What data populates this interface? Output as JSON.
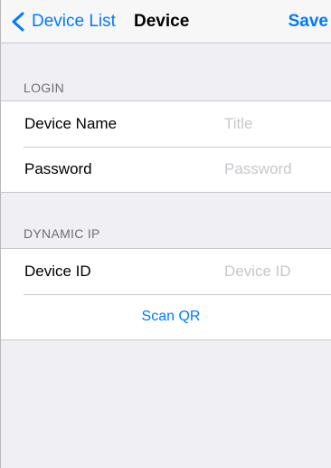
{
  "navbar": {
    "back_label": "Device List",
    "title": "Device",
    "save_label": "Save"
  },
  "sections": {
    "login": {
      "header": "LOGIN",
      "device_name": {
        "label": "Device Name",
        "placeholder": "Title",
        "value": ""
      },
      "password": {
        "label": "Password",
        "placeholder": "Password",
        "value": ""
      }
    },
    "dynamic_ip": {
      "header": "DYNAMIC IP",
      "device_id": {
        "label": "Device ID",
        "placeholder": "Device ID",
        "value": ""
      },
      "scan_label": "Scan QR"
    }
  },
  "colors": {
    "tint": "#007aff",
    "background": "#efeff4",
    "separator": "#c8c7cc",
    "header_text": "#6d6d72",
    "placeholder": "#c7c7cd"
  },
  "icons": {
    "back": "chevron-left-icon"
  }
}
